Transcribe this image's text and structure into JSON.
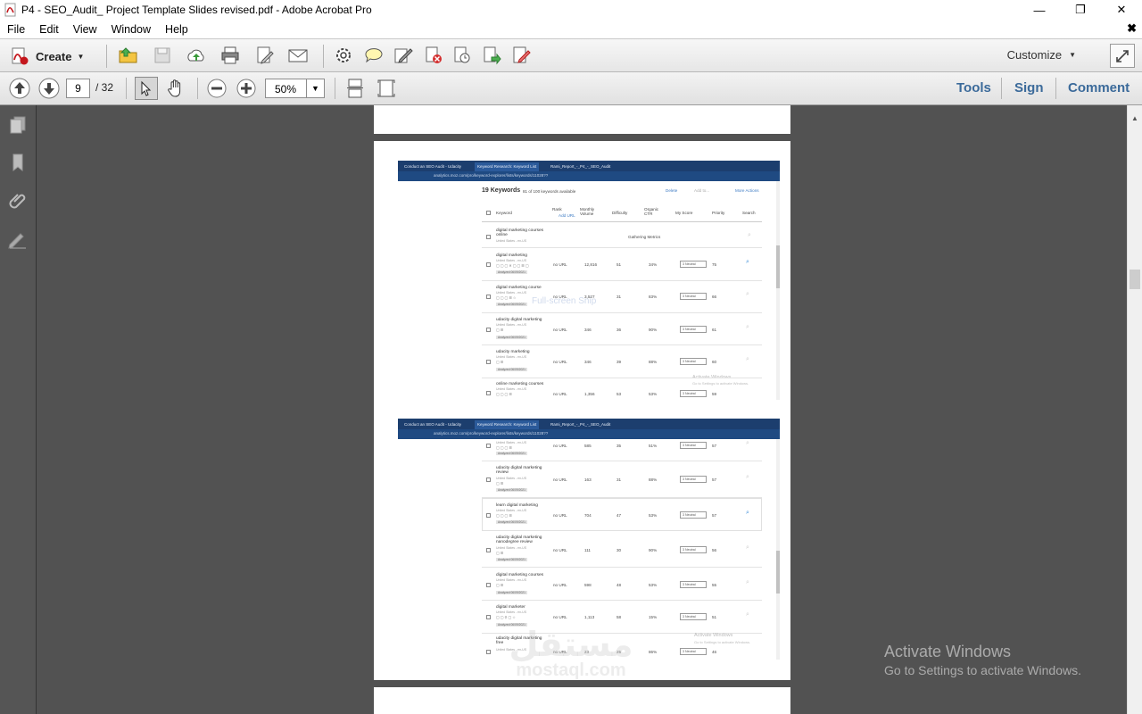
{
  "window": {
    "title": "P4 - SEO_Audit_ Project Template Slides revised.pdf - Adobe Acrobat Pro",
    "minimize_glyph": "—",
    "maximize_glyph": "❐",
    "close_glyph": "✕"
  },
  "menu": {
    "items": [
      "File",
      "Edit",
      "View",
      "Window",
      "Help"
    ],
    "doc_close": "✖"
  },
  "toolbar": {
    "create_label": "Create",
    "customize_label": "Customize"
  },
  "nav": {
    "current_page": "9",
    "total_pages": "/ 32",
    "zoom": "50%",
    "links": [
      "Tools",
      "Sign",
      "Comment"
    ]
  },
  "shot1": {
    "tabs": [
      "Conduct an SEO Audit - Udacity",
      "Keyword Research: Keyword List",
      "Rami_Report_-_P4_-_SEO_Audit"
    ],
    "url": "analytics.moz.com/pro/keyword-explorer/lists/keywords/11028??",
    "heading": "19 Keywords",
    "subheading": "81 of 100 keywords available",
    "actions": [
      "Delete",
      "Add to...",
      "More Actions"
    ],
    "columns": [
      "Keyword",
      "Rank",
      "Add URL",
      "Monthly Volume",
      "Difficulty",
      "Organic CTR",
      "My Score",
      "Priority",
      "Search"
    ],
    "gathering": "Gathering Metrics",
    "rows": [
      {
        "keyword": "digital marketing courses online",
        "loc": "United States - en-US",
        "rank": "",
        "volume": "",
        "difficulty": "",
        "ctr": "",
        "score": "",
        "priority": ""
      },
      {
        "keyword": "digital marketing",
        "loc": "United States - en-US",
        "analyzed": "Analyzed 06/09/2021",
        "rank": "no URL",
        "volume": "12,816",
        "difficulty": "51",
        "ctr": "34%",
        "score": "3 Neutral",
        "priority": "75"
      },
      {
        "keyword": "digital marketing course",
        "loc": "United States - en-US",
        "analyzed": "Analyzed 06/09/2021",
        "rank": "no URL",
        "volume": "3,527",
        "difficulty": "31",
        "ctr": "83%",
        "score": "3 Neutral",
        "priority": "66"
      },
      {
        "keyword": "udacity digital marketing",
        "loc": "United States - en-US",
        "analyzed": "Analyzed 06/09/2021",
        "rank": "no URL",
        "volume": "346",
        "difficulty": "36",
        "ctr": "90%",
        "score": "3 Neutral",
        "priority": "61"
      },
      {
        "keyword": "udacity marketing",
        "loc": "United States - en-US",
        "analyzed": "Analyzed 06/09/2021",
        "rank": "no URL",
        "volume": "346",
        "difficulty": "39",
        "ctr": "88%",
        "score": "3 Neutral",
        "priority": "60"
      },
      {
        "keyword": "online marketing courses",
        "loc": "United States - en-US",
        "analyzed": "",
        "rank": "no URL",
        "volume": "1,356",
        "difficulty": "53",
        "ctr": "53%",
        "score": "3 Neutral",
        "priority": "59"
      }
    ],
    "snip": "Full-screen Snip",
    "activate": "Activate Windows",
    "activate_sub": "Go to Settings to activate Windows."
  },
  "shot2": {
    "tabs": [
      "Conduct an SEO Audit - Udacity",
      "Keyword Research: Keyword List",
      "Rami_Report_-_P4_-_SEO_Audit"
    ],
    "url": "analytics.moz.com/pro/keyword-explorer/lists/keywords/11028??",
    "rows": [
      {
        "keyword": "",
        "loc": "United States - en-US",
        "analyzed": "Analyzed 06/09/2021",
        "rank": "no URL",
        "volume": "585",
        "difficulty": "35",
        "ctr": "51%",
        "score": "3 Neutral",
        "priority": "57"
      },
      {
        "keyword": "udacity digital marketing review",
        "loc": "United States - en-US",
        "analyzed": "Analyzed 06/09/2021",
        "rank": "no URL",
        "volume": "163",
        "difficulty": "31",
        "ctr": "88%",
        "score": "3 Neutral",
        "priority": "57"
      },
      {
        "keyword": "learn digital marketing",
        "loc": "United States - en-US",
        "analyzed": "Analyzed 06/09/2021",
        "rank": "no URL",
        "volume": "704",
        "difficulty": "47",
        "ctr": "53%",
        "score": "3 Neutral",
        "priority": "57"
      },
      {
        "keyword": "udacity digital marketing nanodegree review",
        "loc": "United States - en-US",
        "analyzed": "Analyzed 06/09/2021",
        "rank": "no URL",
        "volume": "111",
        "difficulty": "30",
        "ctr": "90%",
        "score": "3 Neutral",
        "priority": "56"
      },
      {
        "keyword": "digital marketing courses",
        "loc": "United States - en-US",
        "analyzed": "Analyzed 06/09/2021",
        "rank": "no URL",
        "volume": "598",
        "difficulty": "48",
        "ctr": "53%",
        "score": "3 Neutral",
        "priority": "55"
      },
      {
        "keyword": "digital marketer",
        "loc": "United States - en-US",
        "analyzed": "Analyzed 06/09/2021",
        "rank": "no URL",
        "volume": "1,113",
        "difficulty": "58",
        "ctr": "15%",
        "score": "3 Neutral",
        "priority": "51"
      },
      {
        "keyword": "udacity digital marketing free",
        "loc": "United States - en-US",
        "analyzed": "",
        "rank": "no URL",
        "volume": "23",
        "difficulty": "25",
        "ctr": "86%",
        "score": "3 Neutral",
        "priority": "46"
      }
    ],
    "activate": "Activate Windows",
    "activate_sub": "Go to Settings to activate Windows."
  },
  "desktop": {
    "activate_title": "Activate Windows",
    "activate_sub": "Go to Settings to activate Windows."
  },
  "watermark": {
    "arabic": "مستقل",
    "latin": "mostaql.com"
  }
}
